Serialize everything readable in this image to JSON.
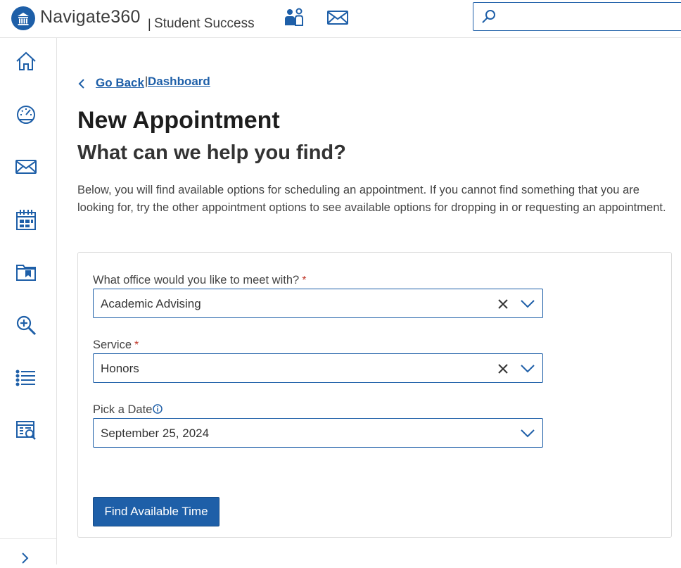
{
  "header": {
    "brand": "Navigate360",
    "separator": "|",
    "product": "Student Success",
    "search": {
      "placeholder": "",
      "value": ""
    }
  },
  "icons": {
    "logo": "navigate-logo",
    "staff": "people-icon",
    "mail": "mail-icon",
    "search": "search-icon"
  },
  "sidebar": {
    "items": [
      {
        "name": "home-icon"
      },
      {
        "name": "dashboard-gauge-icon"
      },
      {
        "name": "messages-icon"
      },
      {
        "name": "calendar-icon"
      },
      {
        "name": "folder-icon"
      },
      {
        "name": "zoom-search-icon"
      },
      {
        "name": "list-icon"
      },
      {
        "name": "report-icon"
      }
    ],
    "expand_icon": "chevron-right-icon"
  },
  "breadcrumb": {
    "back_label": "Go Back",
    "separator": "|",
    "dashboard_label": "Dashboard"
  },
  "page": {
    "title": "New Appointment",
    "subtitle": "What can we help you find?",
    "intro": "Below, you will find available options for scheduling an appointment. If you cannot find something that you are looking for, try the other appointment options to see available options for dropping in or requesting an appointment."
  },
  "form": {
    "office": {
      "label": "What office would you like to meet with?",
      "required_mark": "*",
      "value": "Academic Advising"
    },
    "service": {
      "label": "Service",
      "required_mark": "*",
      "value": "Honors"
    },
    "date": {
      "label": "Pick a Date",
      "value": "September 25, 2024"
    },
    "submit_label": "Find Available Time"
  },
  "colors": {
    "accent": "#1e5fa8",
    "required": "#c0392b",
    "border": "#dcdcdc"
  }
}
